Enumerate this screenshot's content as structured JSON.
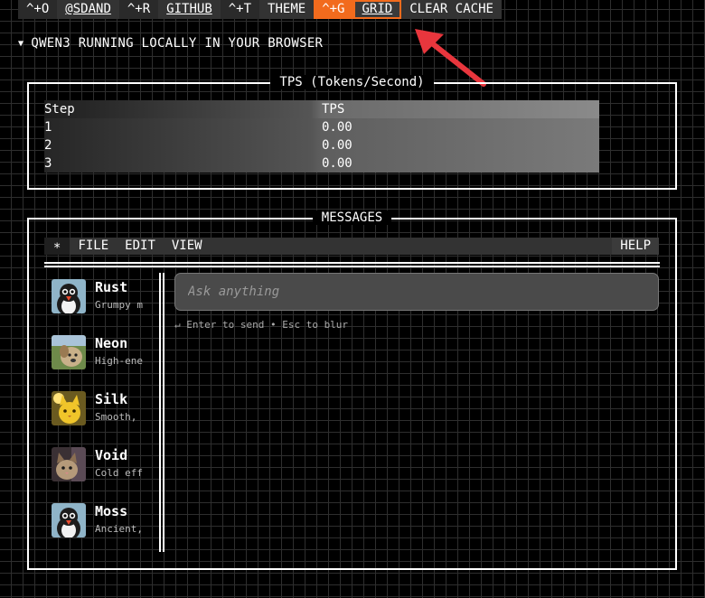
{
  "topbar": {
    "items": [
      {
        "label": "^+O",
        "style": "key"
      },
      {
        "label": "@SDAND",
        "style": "link"
      },
      {
        "label": "^+R",
        "style": "key"
      },
      {
        "label": "GITHUB",
        "style": "link"
      },
      {
        "label": "^+T",
        "style": "key"
      },
      {
        "label": "THEME",
        "style": "normal"
      },
      {
        "label": "^+G",
        "style": "orange"
      },
      {
        "label": "GRID",
        "style": "grid-on"
      },
      {
        "label": "CLEAR CACHE",
        "style": "normal"
      }
    ]
  },
  "header": {
    "title": "QWEN3 RUNNING LOCALLY IN YOUR BROWSER"
  },
  "tps": {
    "title": "TPS (Tokens/Second)",
    "columns": [
      "Step",
      "TPS"
    ],
    "rows": [
      [
        "1",
        "0.00"
      ],
      [
        "2",
        "0.00"
      ],
      [
        "3",
        "0.00"
      ]
    ]
  },
  "messages": {
    "title": "MESSAGES",
    "menu": {
      "star": "∗",
      "file": "FILE",
      "edit": "EDIT",
      "view": "VIEW",
      "help": "HELP"
    },
    "personas": [
      {
        "name": "Rust",
        "desc": "Grumpy m",
        "icon": "penguin-avatar"
      },
      {
        "name": "Neon",
        "desc": "High-ene",
        "icon": "dog-avatar"
      },
      {
        "name": "Silk",
        "desc": "Smooth,",
        "icon": "cat-avatar"
      },
      {
        "name": "Void",
        "desc": "Cold eff",
        "icon": "cat-avatar"
      },
      {
        "name": "Moss",
        "desc": "Ancient,",
        "icon": "penguin-avatar"
      }
    ],
    "input": {
      "placeholder": "Ask anything",
      "value": ""
    },
    "hint": "↵ Enter to send • Esc to blur"
  },
  "colors": {
    "accent": "#f26b1d",
    "annotation_arrow": "#e8363d"
  }
}
